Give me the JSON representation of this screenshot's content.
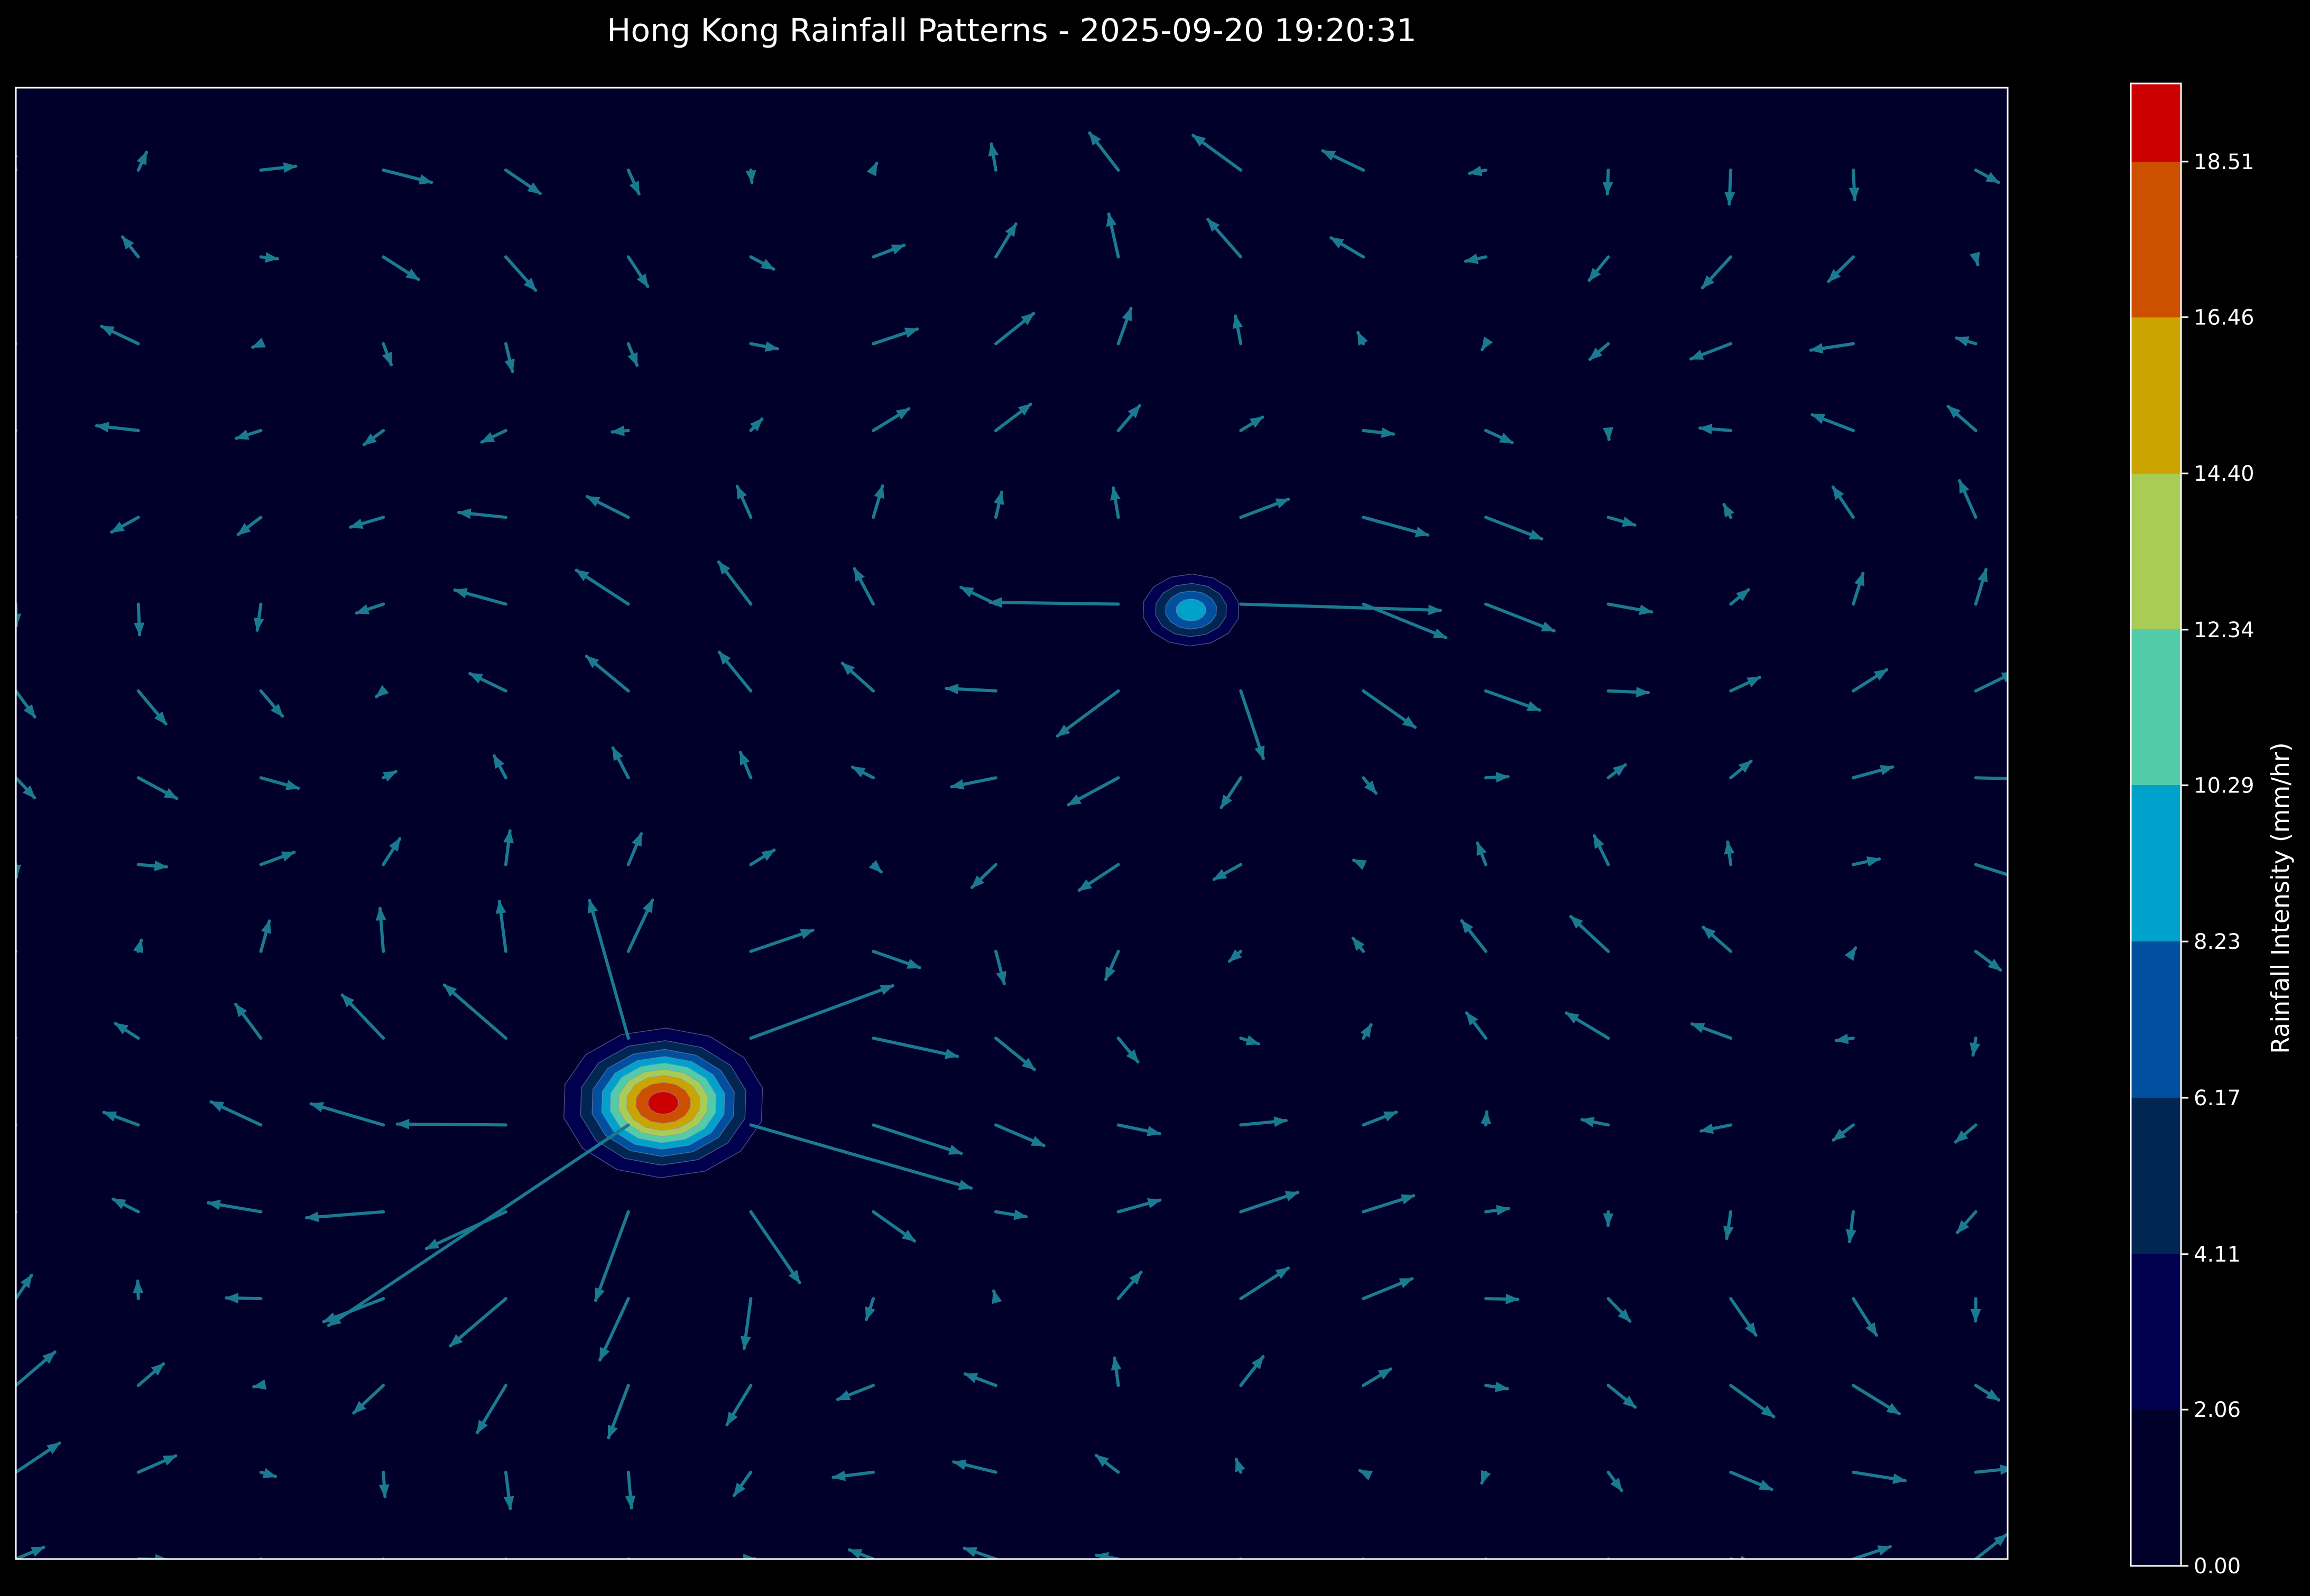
{
  "chart_data": {
    "type": "heatmap",
    "title": "Hong Kong Rainfall Patterns - 2025-09-20 19:20:31",
    "xlabel": "",
    "ylabel": "",
    "xlim": [
      0,
      10
    ],
    "ylim": [
      0,
      10
    ],
    "grid": false,
    "legend": "none",
    "colorbar": {
      "label": "Rainfall Intensity (mm/hr)",
      "range": [
        0.0,
        19.54
      ],
      "ticks": [
        0.0,
        2.06,
        4.11,
        6.17,
        8.23,
        10.29,
        12.34,
        14.4,
        16.46,
        18.51
      ],
      "tick_labels": [
        "0.00",
        "2.06",
        "4.11",
        "6.17",
        "8.23",
        "10.29",
        "12.34",
        "14.40",
        "16.46",
        "18.51"
      ],
      "level_colors": [
        "#00002a",
        "#00004f",
        "#002654",
        "#00509f",
        "#00a2cc",
        "#52cca8",
        "#a8cc56",
        "#cca400",
        "#cc5000",
        "#cc0000"
      ]
    },
    "rain_cells": [
      {
        "x": 3.25,
        "y": 3.1,
        "peak": 19.5,
        "sigma": 0.24
      },
      {
        "x": 5.9,
        "y": 6.45,
        "peak": 9.5,
        "sigma": 0.14
      }
    ],
    "wind_field": {
      "grid_x": [
        0.0,
        0.615,
        1.23,
        1.845,
        2.46,
        3.075,
        3.69,
        4.305,
        4.92,
        5.535,
        6.15,
        6.765,
        7.38,
        7.995,
        8.61,
        9.225,
        9.84
      ],
      "grid_y": [
        0.0,
        0.59,
        1.18,
        1.77,
        2.36,
        2.95,
        3.54,
        4.13,
        4.72,
        5.31,
        5.9,
        6.49,
        7.08,
        7.67,
        8.26,
        8.85,
        9.44
      ],
      "arrow_color": "#1a7a90"
    }
  }
}
